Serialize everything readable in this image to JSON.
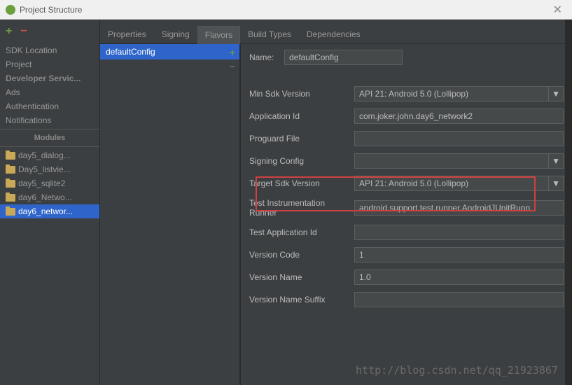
{
  "window": {
    "title": "Project Structure",
    "close": "✕"
  },
  "sidebar": {
    "items": [
      {
        "label": "SDK Location"
      },
      {
        "label": "Project"
      }
    ],
    "dev_heading": "Developer Servic...",
    "dev_items": [
      {
        "label": "Ads"
      },
      {
        "label": "Authentication"
      },
      {
        "label": "Notifications"
      }
    ],
    "modules_heading": "Modules",
    "modules": [
      {
        "label": "day5_dialog..."
      },
      {
        "label": "Day5_listvie..."
      },
      {
        "label": "day5_sqlite2"
      },
      {
        "label": "day6_Netwo..."
      },
      {
        "label": "day6_networ...",
        "selected": true
      }
    ]
  },
  "tabs": [
    {
      "label": "Properties"
    },
    {
      "label": "Signing"
    },
    {
      "label": "Flavors",
      "active": true
    },
    {
      "label": "Build Types"
    },
    {
      "label": "Dependencies"
    }
  ],
  "configs": {
    "selected": "defaultConfig"
  },
  "form": {
    "name_label": "Name:",
    "name_value": "defaultConfig",
    "fields": {
      "min_sdk": {
        "label": "Min Sdk Version",
        "value": "API 21: Android 5.0 (Lollipop)"
      },
      "app_id": {
        "label": "Application Id",
        "value": "com.joker.john.day6_network2"
      },
      "proguard": {
        "label": "Proguard File",
        "value": ""
      },
      "signing": {
        "label": "Signing Config",
        "value": ""
      },
      "target_sdk": {
        "label": "Target Sdk Version",
        "value": "API 21: Android 5.0 (Lollipop)"
      },
      "test_runner": {
        "label": "Test Instrumentation Runner",
        "value": "android.support.test.runner.AndroidJUnitRunn"
      },
      "test_app_id": {
        "label": "Test Application Id",
        "value": ""
      },
      "version_code": {
        "label": "Version Code",
        "value": "1"
      },
      "version_name": {
        "label": "Version Name",
        "value": "1.0"
      },
      "version_suffix": {
        "label": "Version Name Suffix",
        "value": ""
      }
    }
  },
  "watermark": "http://blog.csdn.net/qq_21923867"
}
